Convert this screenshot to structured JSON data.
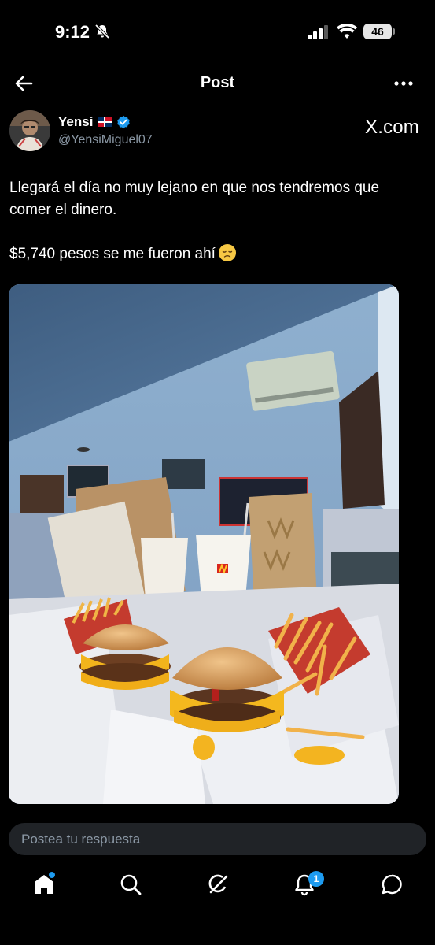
{
  "status_bar": {
    "time": "9:12",
    "battery": "46"
  },
  "header": {
    "title": "Post"
  },
  "author": {
    "name": "Yensi",
    "handle": "@YensiMiguel07",
    "flag": "dominican-republic-flag",
    "verified": true
  },
  "watermark": "X.com",
  "post": {
    "line1": "Llegará el día no muy lejano en que nos tendremos que comer el dinero.",
    "line2": "$5,740 pesos se me fueron ahí",
    "emoji": "disappointed-face"
  },
  "photo": {
    "description_icon": "fast-food-photo"
  },
  "reply": {
    "placeholder": "Postea tu respuesta"
  },
  "nav": {
    "items": [
      "home-icon",
      "search-icon",
      "grok-icon",
      "notifications-icon",
      "messages-icon"
    ],
    "notification_count": "1"
  },
  "colors": {
    "accent": "#1d9bf0",
    "background": "#000000",
    "muted": "#8b98a5"
  }
}
